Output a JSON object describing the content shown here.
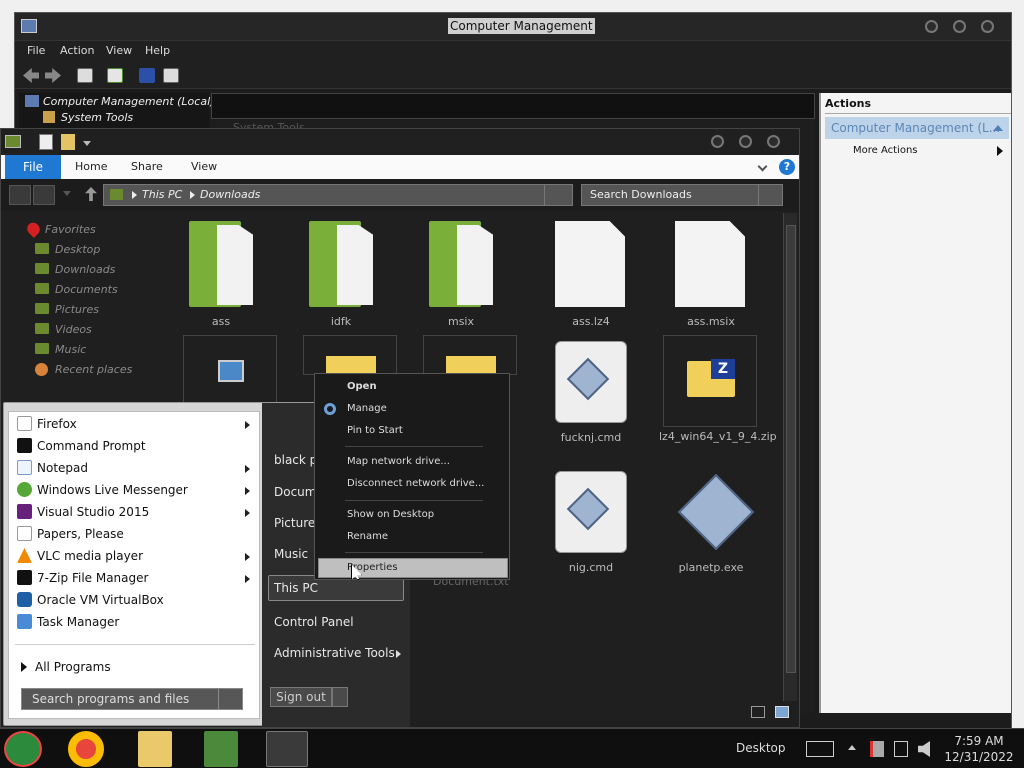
{
  "cm": {
    "title": "Computer Management",
    "menu": [
      "File",
      "Action",
      "View",
      "Help"
    ],
    "tree": {
      "root": "Computer Management (Local)",
      "child": "System Tools"
    },
    "center_ghost": "System Tools",
    "actions": {
      "header": "Actions",
      "selected": "Computer Management (L...",
      "more": "More Actions"
    }
  },
  "explorer": {
    "ribbon": {
      "file": "File",
      "home": "Home",
      "share": "Share",
      "view": "View",
      "help": "?"
    },
    "address": {
      "root": "This PC",
      "folder": "Downloads"
    },
    "search_placeholder": "Search Downloads",
    "nav": [
      "Favorites",
      "Desktop",
      "Downloads",
      "Documents",
      "Pictures",
      "Videos",
      "Music",
      "Recent places"
    ],
    "files": [
      "ass",
      "idfk",
      "msix",
      "ass.lz4",
      "ass.msix",
      "fucknj.cmd",
      "lz4_win64_v1_9_4.zip",
      "nig.cmd",
      "planetp.exe"
    ],
    "partial_label": "Document.txt"
  },
  "start": {
    "programs": [
      "Firefox",
      "Command Prompt",
      "Notepad",
      "Windows Live Messenger",
      "Visual Studio 2015",
      "Papers, Please",
      "VLC media player",
      "7-Zip File Manager",
      "Oracle VM VirtualBox",
      "Task Manager"
    ],
    "all_programs": "All Programs",
    "search_placeholder": "Search programs and files",
    "right": [
      "black pe",
      "Docume",
      "Pictures",
      "Music",
      "This PC",
      "Control Panel",
      "Administrative Tools"
    ],
    "sign_out": "Sign out"
  },
  "context_menu": [
    "Open",
    "Manage",
    "Pin to Start",
    "Map network drive...",
    "Disconnect network drive...",
    "Show on Desktop",
    "Rename",
    "Properties"
  ],
  "taskbar": {
    "desktop": "Desktop",
    "time": "7:59 AM",
    "date": "12/31/2022"
  },
  "colors": {
    "accent": "#1f78d1",
    "folder_green": "#7ab03a",
    "selection": "#bcd3ea"
  }
}
